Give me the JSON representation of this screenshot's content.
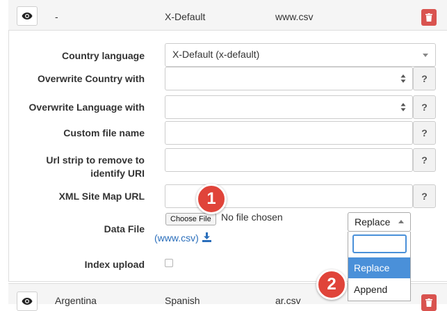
{
  "top_row": {
    "country": "-",
    "language": "X-Default",
    "file": "www.csv"
  },
  "form": {
    "country_language": {
      "label": "Country language",
      "value": "X-Default (x-default)"
    },
    "overwrite_country": {
      "label": "Overwrite Country with",
      "value": ""
    },
    "overwrite_language": {
      "label": "Overwrite Language with",
      "value": ""
    },
    "custom_file_name": {
      "label": "Custom file name",
      "value": ""
    },
    "url_strip": {
      "label_line1": "Url strip to remove to",
      "label_line2": "identify URI",
      "value": ""
    },
    "xml_sitemap": {
      "label": "XML Site Map URL",
      "value": ""
    },
    "data_file": {
      "label": "Data File",
      "choose_label": "Choose File",
      "no_file_text": "No file chosen",
      "download_link": "(www.csv)"
    },
    "index_upload": {
      "label": "Index upload",
      "checked": false
    },
    "help_label": "?"
  },
  "mode_select": {
    "selected": "Replace",
    "search_value": "",
    "options": [
      "Replace",
      "Append"
    ],
    "highlighted": "Replace"
  },
  "annotations": {
    "badge1": "1",
    "badge2": "2"
  },
  "next_row": {
    "country": "Argentina",
    "language": "Spanish",
    "file": "ar.csv"
  },
  "colors": {
    "danger": "#d9534f",
    "accent": "#4a90d9",
    "badge": "#e0443a",
    "link": "#2a6ebb"
  },
  "icons": [
    "eye-icon",
    "trash-icon",
    "download-icon",
    "caret-down-icon",
    "spinner-icon",
    "caret-up-icon"
  ]
}
